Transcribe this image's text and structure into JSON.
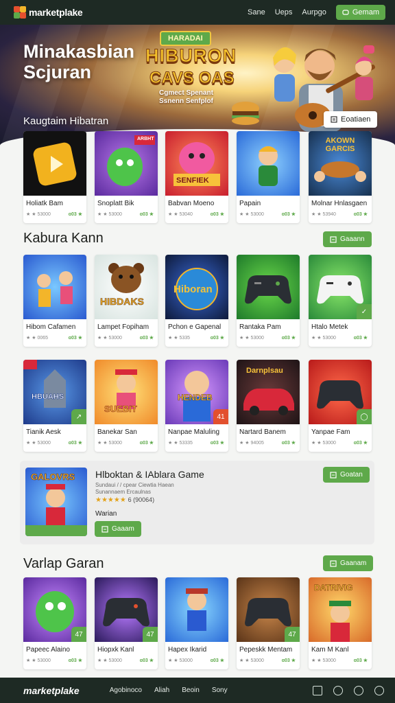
{
  "header": {
    "logo_text": "marketplake",
    "nav": [
      "Sane",
      "Ueps",
      "Aurpgo"
    ],
    "cta": "Gemam"
  },
  "hero": {
    "title_line1": "Minakasbian",
    "title_line2": "Scjuran",
    "subtitle": "Kaugtaim Hibatran",
    "badge": "HARADAI",
    "logo_line1": "HIBURON",
    "logo_line2": "CAVS OAS",
    "logo_line3a": "Cgmect Spenant",
    "logo_line3b": "Ssnenn Senfplof",
    "cta": "Eoatiaen"
  },
  "row1": [
    {
      "title": "Holiatk Bam",
      "meta": "★ ★ 53000",
      "rate": "ɑ03 ★",
      "thumb_label": ""
    },
    {
      "title": "Snoplatt Bik",
      "meta": "★ ★ 53000",
      "rate": "ɑ03 ★",
      "thumb_label": "ARBHT"
    },
    {
      "title": "Babvan Moeno",
      "meta": "★ ★ 53040",
      "rate": "ɑ03 ★",
      "thumb_label": "SENFIEK"
    },
    {
      "title": "Papain",
      "meta": "★ ★ 53000",
      "rate": "ɑ03 ★",
      "thumb_label": ""
    },
    {
      "title": "Molnar Hnlasgaen",
      "meta": "★ ★ 53940",
      "rate": "ɑ03 ★",
      "thumb_label": "AKOWN GARCIS"
    }
  ],
  "section2": {
    "title": "Kabura Kann",
    "button": "Gaaann"
  },
  "row2": [
    {
      "title": "Hibom Cafamen",
      "meta": "★ ★ 0065",
      "rate": "ɑ03 ★",
      "thumb_label": ""
    },
    {
      "title": "Lampet Fopiham",
      "meta": "★ ★ 53000",
      "rate": "ɑ03 ★",
      "thumb_label": "HIBDAKS"
    },
    {
      "title": "Pchon e Gapenal",
      "meta": "★ ★ 5335",
      "rate": "ɑ03 ★",
      "thumb_label": "Hiboran"
    },
    {
      "title": "Rantaka Pam",
      "meta": "★ ★ 53000",
      "rate": "ɑ03 ★",
      "thumb_label": ""
    },
    {
      "title": "Htalo Metek",
      "meta": "★ ★ 53000",
      "rate": "ɑ03 ★",
      "thumb_label": ""
    }
  ],
  "row3": [
    {
      "title": "Tianik Aesk",
      "meta": "★ ★ 53000",
      "rate": "ɑ03 ★",
      "thumb_label": "HBUAHS"
    },
    {
      "title": "Banekar San",
      "meta": "★ ★ 53000",
      "rate": "ɑ03 ★",
      "thumb_label": "SUEBIT"
    },
    {
      "title": "Nanpae Maluling",
      "meta": "★ ★ 53335",
      "rate": "ɑ03 ★",
      "thumb_label": "HENDEB"
    },
    {
      "title": "Nartard Banem",
      "meta": "★ ★ 94005",
      "rate": "ɑ03 ★",
      "thumb_label": "Darnplsau"
    },
    {
      "title": "Yanpae Fam",
      "meta": "★ ★ 53000",
      "rate": "ɑ03 ★",
      "thumb_label": ""
    }
  ],
  "featured": {
    "thumb_label": "GALOVRS",
    "title": "Hlboktan & IAblara Game",
    "subtitle_line1": "Sundaui / / cpear Ciewtia Haean",
    "subtitle_line2": "Sunannaem Ercaulnas",
    "stars": "★★★★★",
    "rating": "6 (90064)",
    "label": "Warian",
    "button": "Gaaam",
    "side_button": "Goatan"
  },
  "section3": {
    "title": "Varlap Garan",
    "button": "Gaanam"
  },
  "row4": [
    {
      "title": "Papeec Alaino",
      "meta": "★ ★ 53000",
      "rate": "ɑ03 ★",
      "thumb_label": ""
    },
    {
      "title": "Hiopxk Kanl",
      "meta": "★ ★ 53000",
      "rate": "ɑ03 ★",
      "thumb_label": ""
    },
    {
      "title": "Hapex Ikarid",
      "meta": "★ ★ 53000",
      "rate": "ɑ03 ★",
      "thumb_label": ""
    },
    {
      "title": "Pepeskk Mentam",
      "meta": "★ ★ 53000",
      "rate": "ɑ03 ★",
      "thumb_label": ""
    },
    {
      "title": "Kam M Kanl",
      "meta": "★ ★ 53000",
      "rate": "ɑ03 ★",
      "thumb_label": "DATRIVIG"
    }
  ],
  "footer": {
    "logo_text": "marketplake",
    "links": [
      "Agobinoco",
      "Aliah",
      "Beoin",
      "Sony"
    ],
    "icons": [
      "mail-icon",
      "info-icon",
      "location-icon",
      "minus-circle-icon"
    ]
  },
  "colors": {
    "accent": "#5ea94a",
    "dark_bar": "#1e2a24",
    "star": "#e3a21a"
  }
}
